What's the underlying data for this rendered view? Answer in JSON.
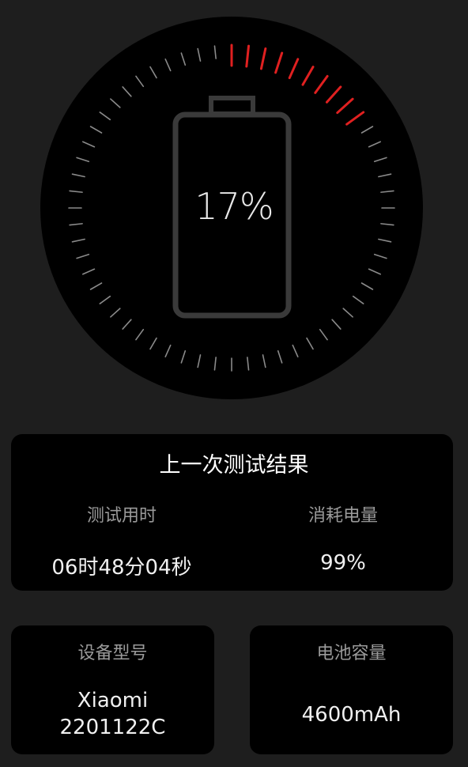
{
  "battery": {
    "percent_label": "17%",
    "level": 0.17,
    "active_color": "#e02020",
    "inactive_color": "#8a8a8a"
  },
  "last_result": {
    "title": "上一次测试结果",
    "duration_label": "测试用时",
    "duration_value": "06时48分04秒",
    "consumed_label": "消耗电量",
    "consumed_value": "99%"
  },
  "device": {
    "label": "设备型号",
    "value_line1": "Xiaomi",
    "value_line2": "2201122C"
  },
  "capacity": {
    "label": "电池容量",
    "value": "4600mAh"
  }
}
